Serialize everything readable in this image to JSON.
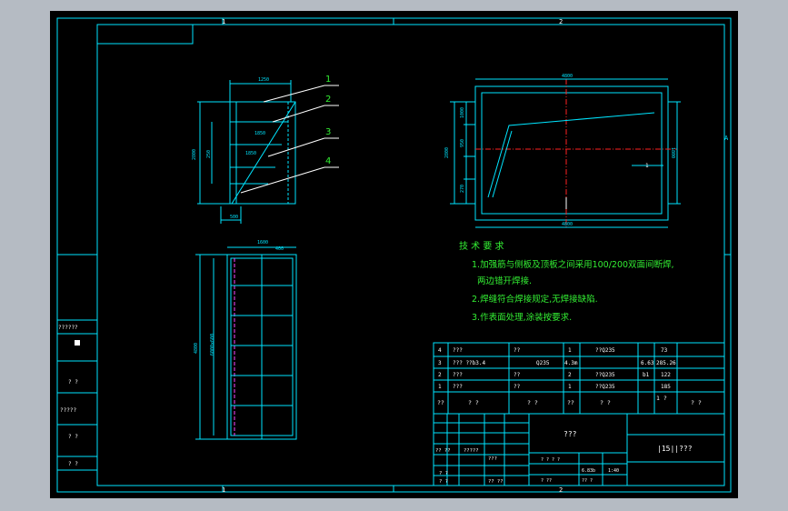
{
  "colors": {
    "background": "#000000",
    "frame": "#00e5ff",
    "text": "#33ee33",
    "dim": "#00e5ff",
    "hidden": "#ff44ff",
    "center": "#ff2222",
    "window_bg": "#b5bbc3"
  },
  "border": {
    "top_marks": [
      "1",
      "2"
    ],
    "bottom_marks": [
      "1",
      "2"
    ],
    "side_mark": "A"
  },
  "views": {
    "side": {
      "top_dim": "1250",
      "left_dims": [
        "2800",
        "250",
        "250"
      ],
      "bottom_dim": "500",
      "inner_dims": [
        "1850",
        "1850"
      ],
      "callouts": [
        "1",
        "2",
        "3",
        "4"
      ]
    },
    "front": {
      "top_dim": "4800",
      "bottom_dim": "4800",
      "left_dims": [
        "2800",
        "1000",
        "950",
        "270"
      ],
      "right_dim": "1800",
      "mark": "1"
    },
    "plan": {
      "top_dims": [
        "1600",
        "400"
      ],
      "left_dims": [
        "4800",
        "6000x600"
      ]
    }
  },
  "notes": {
    "title": "技 术 要 求",
    "lines": [
      "1.加强筋与侧板及顶板之间采用100/200双面间断焊,",
      "两边错开焊接.",
      "2.焊缝符合焊接规定,无焊接缺陷.",
      "3.作表面处理,涂装按要求."
    ]
  },
  "bom": {
    "rows": [
      [
        "4",
        "???",
        "??",
        "1",
        "??Q235",
        "",
        "73"
      ],
      [
        "3",
        "??? ??b3.4",
        "Q235",
        "4.3m",
        "6.63",
        "285.26",
        ""
      ],
      [
        "2",
        "???",
        "??",
        "2",
        "??Q235",
        "b1",
        "122"
      ],
      [
        "1",
        "???",
        "??",
        "1",
        "??Q235",
        "",
        "185"
      ]
    ],
    "header": [
      "??",
      "? ?",
      "? ?",
      "??",
      "? ?",
      "1 ?",
      "? ?"
    ]
  },
  "title_block": {
    "name": "???",
    "drawing_no": "|15||???",
    "cells": [
      "?? ??",
      "?????",
      "???",
      "? ?",
      "? ?",
      "?? ??"
    ],
    "small": [
      "? ? ? ?",
      "? ??",
      "?? ?",
      "6.83b",
      "1:40"
    ]
  },
  "left_strip": [
    "??????",
    "? ?",
    "?????",
    "? ?",
    "? ?"
  ]
}
